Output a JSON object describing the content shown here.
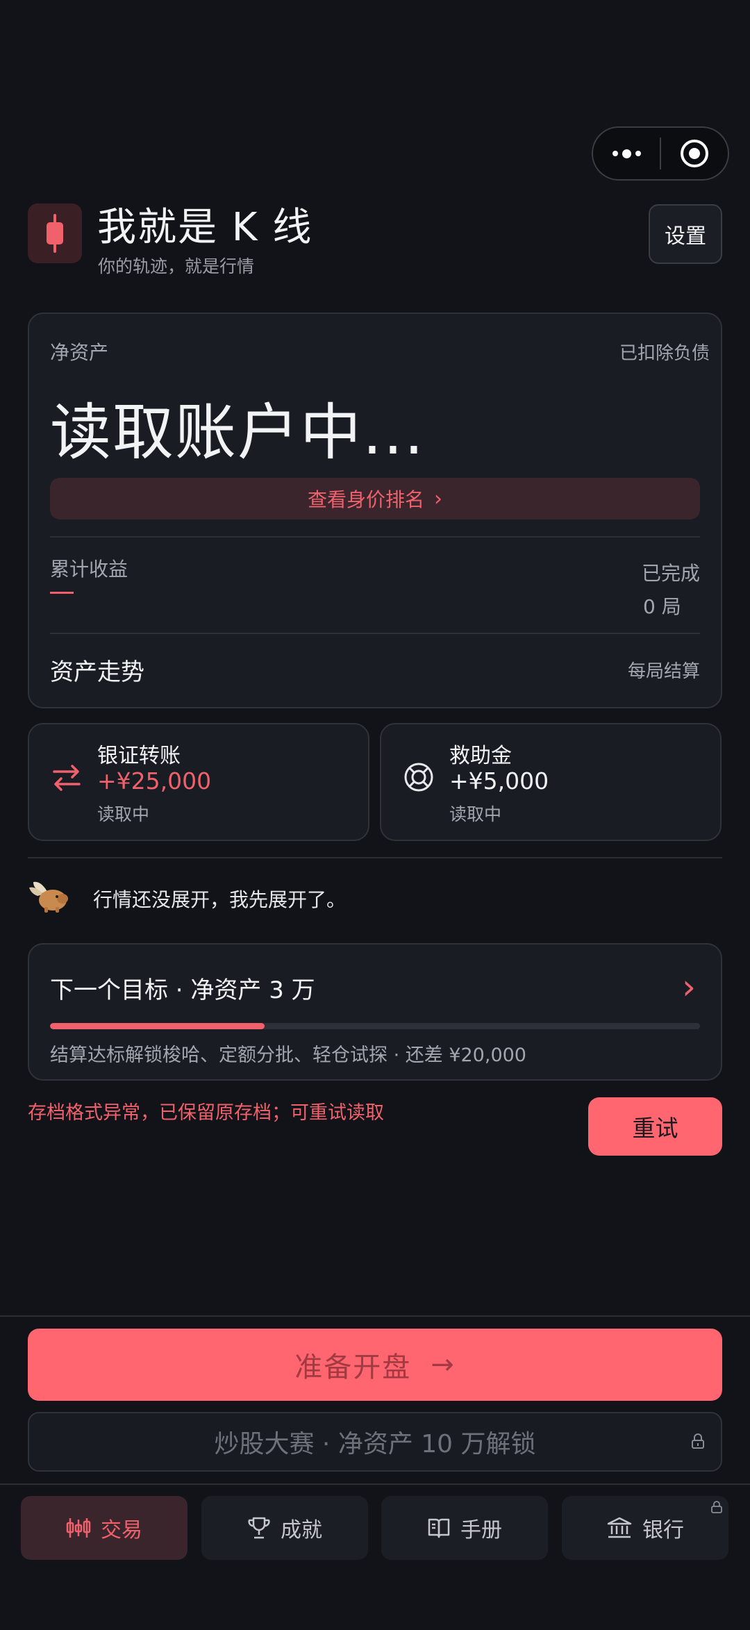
{
  "header": {
    "title": "我就是 K 线",
    "subtitle": "你的轨迹，就是行情",
    "settings_label": "设置"
  },
  "asset_card": {
    "net_label": "净资产",
    "net_note": "已扣除负债",
    "net_value": "读取账户中...",
    "rank_button": "查看身价排名",
    "rank_chevron": "›",
    "profit_label": "累计收益",
    "completed_label": "已完成",
    "completed_value": "0 局",
    "trend_title": "资产走势",
    "trend_note": "每局结算"
  },
  "transfer": {
    "title": "银证转账",
    "amount": "+¥25,000",
    "status": "读取中"
  },
  "relief": {
    "title": "救助金",
    "amount": "+¥5,000",
    "status": "读取中"
  },
  "mascot": {
    "message": "行情还没展开，我先展开了。"
  },
  "goal": {
    "title": "下一个目标 · 净资产 3 万",
    "chevron": "›",
    "progress": 0.33,
    "description": "结算达标解锁梭哈、定额分批、轻仓试探 · 还差 ¥20,000"
  },
  "error": {
    "message": "存档格式异常，已保留原存档；可重试读取",
    "retry_label": "重试"
  },
  "actions": {
    "start_label": "准备开盘",
    "start_arrow": "→",
    "contest_label": "炒股大赛 · 净资产 10 万解锁"
  },
  "tabs": [
    {
      "label": "交易",
      "icon": "candlestick-icon",
      "active": true
    },
    {
      "label": "成就",
      "icon": "trophy-icon",
      "active": false
    },
    {
      "label": "手册",
      "icon": "book-icon",
      "active": false
    },
    {
      "label": "银行",
      "icon": "bank-icon",
      "active": false,
      "locked": true
    }
  ],
  "colors": {
    "accent": "#ff6670",
    "accent_text": "#f0616c",
    "background": "#111318",
    "card": "#191c23"
  }
}
